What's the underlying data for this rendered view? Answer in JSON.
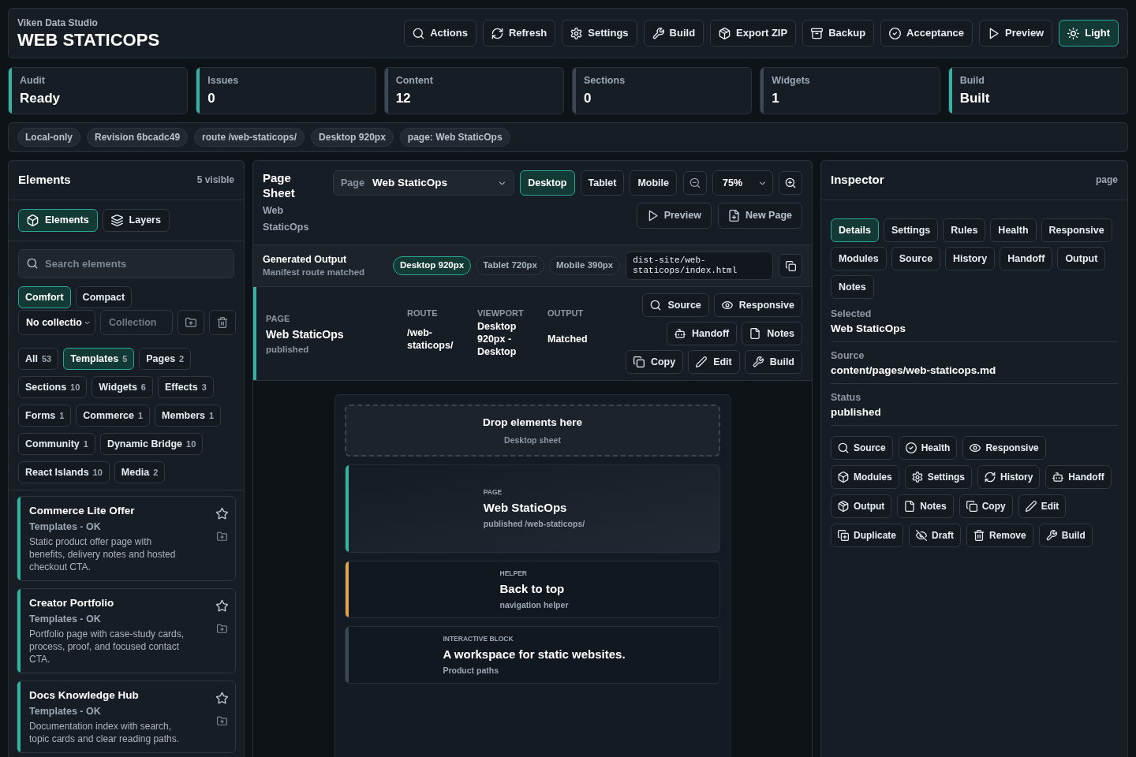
{
  "header": {
    "org": "Viken Data Studio",
    "title": "WEB STATICOPS",
    "actions": [
      {
        "label": "Actions",
        "on": false
      },
      {
        "label": "Refresh",
        "on": false
      },
      {
        "label": "Settings",
        "on": false
      },
      {
        "label": "Build",
        "on": false
      },
      {
        "label": "Export ZIP",
        "on": false
      },
      {
        "label": "Backup",
        "on": false
      },
      {
        "label": "Acceptance",
        "on": false
      },
      {
        "label": "Preview",
        "on": false
      },
      {
        "label": "Light",
        "on": true
      }
    ]
  },
  "stats": [
    {
      "label": "Audit",
      "value": "Ready",
      "color": "#34b3a2"
    },
    {
      "label": "Issues",
      "value": "0",
      "color": "#34b3a2"
    },
    {
      "label": "Content",
      "value": "12",
      "color": "#3b4855"
    },
    {
      "label": "Sections",
      "value": "0",
      "color": "#3b4855"
    },
    {
      "label": "Widgets",
      "value": "1",
      "color": "#3b4855"
    },
    {
      "label": "Build",
      "value": "Built",
      "color": "#34b3a2"
    }
  ],
  "context_tags": [
    "Local-only",
    "Revision 6bcadc49",
    "route /web-staticops/",
    "Desktop 920px",
    "page: Web StaticOps"
  ],
  "elements_panel": {
    "title": "Elements",
    "count": "5 visible",
    "tabs": [
      {
        "label": "Elements",
        "selected": true
      },
      {
        "label": "Layers",
        "selected": false
      }
    ],
    "search": {
      "placeholder": "Search elements"
    },
    "density": [
      {
        "label": "Comfort",
        "selected": true
      },
      {
        "label": "Compact",
        "selected": false
      }
    ],
    "collection_select": {
      "value": "No collectio"
    },
    "collection_input": {
      "placeholder": "Collection"
    },
    "filters": [
      {
        "label": "All",
        "count": "53",
        "selected": false
      },
      {
        "label": "Templates",
        "count": "5",
        "selected": true
      },
      {
        "label": "Pages",
        "count": "2",
        "selected": false
      },
      {
        "label": "Sections",
        "count": "10",
        "selected": false
      },
      {
        "label": "Widgets",
        "count": "6",
        "selected": false
      },
      {
        "label": "Effects",
        "count": "3",
        "selected": false
      },
      {
        "label": "Forms",
        "count": "1",
        "selected": false
      },
      {
        "label": "Commerce",
        "count": "1",
        "selected": false
      },
      {
        "label": "Members",
        "count": "1",
        "selected": false
      },
      {
        "label": "Community",
        "count": "1",
        "selected": false
      },
      {
        "label": "Dynamic Bridge",
        "count": "10",
        "selected": false
      },
      {
        "label": "React Islands",
        "count": "10",
        "selected": false
      },
      {
        "label": "Media",
        "count": "2",
        "selected": false
      }
    ],
    "cards": [
      {
        "title": "Commerce Lite Offer",
        "meta": "Templates - OK",
        "description": "Static product offer page with benefits, delivery notes and hosted checkout CTA."
      },
      {
        "title": "Creator Portfolio",
        "meta": "Templates - OK",
        "description": "Portfolio page with case-study cards, process, proof, and focused contact CTA."
      },
      {
        "title": "Docs Knowledge Hub",
        "meta": "Templates - OK",
        "description": "Documentation index with search, topic cards and clear reading paths."
      }
    ]
  },
  "sheet": {
    "title": "Page Sheet",
    "subtitle": "Web StaticOps",
    "page_select": {
      "label": "Page",
      "value": "Web StaticOps"
    },
    "devices": [
      {
        "label": "Desktop",
        "selected": true
      },
      {
        "label": "Tablet",
        "selected": false
      },
      {
        "label": "Mobile",
        "selected": false
      }
    ],
    "zoom": {
      "value": "75%"
    },
    "buttons": [
      "Preview",
      "New Page"
    ],
    "output": {
      "title": "Generated Output",
      "subtitle": "Manifest route matched",
      "viewports": [
        {
          "label": "Desktop 920px",
          "selected": true
        },
        {
          "label": "Tablet 720px",
          "selected": false
        },
        {
          "label": "Mobile 390px",
          "selected": false
        }
      ],
      "path": "dist-site/web-staticops/index.html"
    },
    "page_row": {
      "label": "PAGE",
      "name": "Web StaticOps",
      "status": "published",
      "columns": [
        {
          "heading": "ROUTE",
          "value": "/web-staticops/"
        },
        {
          "heading": "VIEWPORT",
          "value": "Desktop 920px - Desktop"
        },
        {
          "heading": "OUTPUT",
          "value": "Matched"
        }
      ],
      "action_rows": [
        [
          "Source",
          "Responsive"
        ],
        [
          "Handoff",
          "Notes"
        ],
        [
          "Copy",
          "Edit",
          "Build"
        ]
      ]
    },
    "canvas": {
      "drop_zone": {
        "title": "Drop elements here",
        "subtitle": "Desktop sheet"
      },
      "blocks": [
        {
          "label": "PAGE",
          "title": "Web StaticOps",
          "subtitle": "published /web-staticops/",
          "color": "#34b3a2",
          "selected": true
        },
        {
          "label": "HELPER",
          "title": "Back to top",
          "subtitle": "navigation helper",
          "color": "#e0a24a",
          "selected": false
        },
        {
          "label": "INTERACTIVE BLOCK",
          "title": "A workspace for static websites.",
          "subtitle": "Product paths",
          "color": "#3b4855",
          "selected": false
        }
      ]
    }
  },
  "inspector": {
    "title": "Inspector",
    "scope": "page",
    "tabs": [
      {
        "label": "Details",
        "selected": true
      },
      {
        "label": "Settings",
        "selected": false
      },
      {
        "label": "Rules",
        "selected": false
      },
      {
        "label": "Health",
        "selected": false
      },
      {
        "label": "Responsive",
        "selected": false
      },
      {
        "label": "Modules",
        "selected": false
      },
      {
        "label": "Source",
        "selected": false
      },
      {
        "label": "History",
        "selected": false
      },
      {
        "label": "Handoff",
        "selected": false
      },
      {
        "label": "Output",
        "selected": false
      },
      {
        "label": "Notes",
        "selected": false
      }
    ],
    "fields": [
      {
        "label": "Selected",
        "value": "Web StaticOps"
      },
      {
        "label": "Source",
        "value": "content/pages/web-staticops.md"
      },
      {
        "label": "Status",
        "value": "published"
      }
    ],
    "action_rows": [
      [
        "Source",
        "Health",
        "Responsive"
      ],
      [
        "Modules",
        "Settings",
        "History",
        "Handoff"
      ],
      [
        "Output",
        "Notes",
        "Copy",
        "Edit"
      ],
      [
        "Duplicate",
        "Draft",
        "Remove",
        "Build"
      ]
    ]
  }
}
